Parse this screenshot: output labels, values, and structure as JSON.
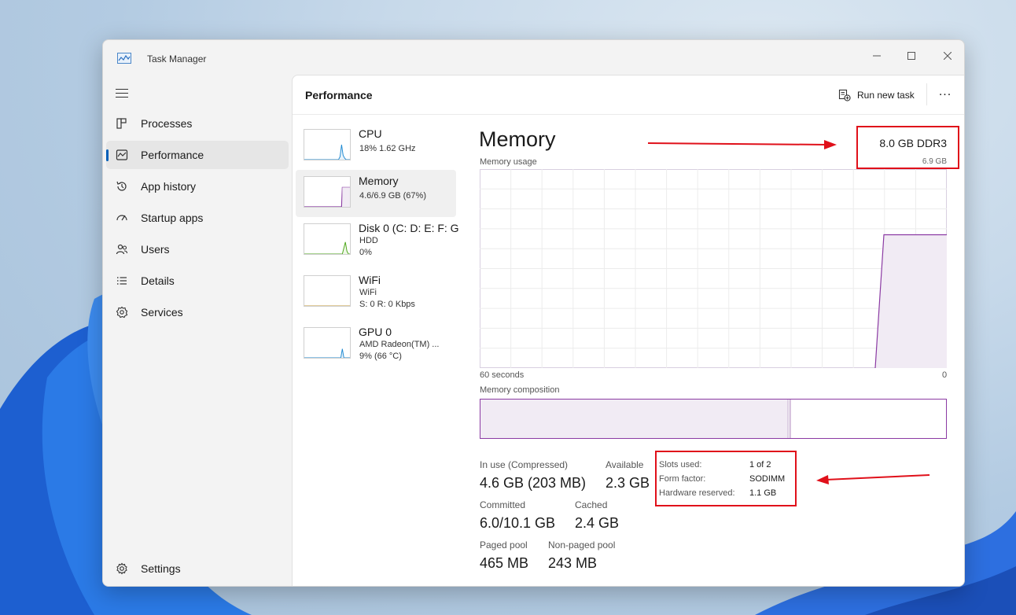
{
  "window": {
    "title": "Task Manager"
  },
  "nav": {
    "items": [
      {
        "label": "Processes",
        "icon": "processes-icon"
      },
      {
        "label": "Performance",
        "icon": "performance-icon",
        "active": true
      },
      {
        "label": "App history",
        "icon": "history-icon"
      },
      {
        "label": "Startup apps",
        "icon": "startup-icon"
      },
      {
        "label": "Users",
        "icon": "users-icon"
      },
      {
        "label": "Details",
        "icon": "details-icon"
      },
      {
        "label": "Services",
        "icon": "services-icon"
      }
    ],
    "settings_label": "Settings"
  },
  "header": {
    "title": "Performance",
    "run_new_task_label": "Run new task",
    "more_label": "..."
  },
  "resources": [
    {
      "name": "CPU",
      "line1": "18% 1.62 GHz",
      "line2": ""
    },
    {
      "name": "Memory",
      "line1": "4.6/6.9 GB (67%)",
      "line2": "",
      "active": true
    },
    {
      "name": "Disk 0 (C: D: E: F: G",
      "line1": "HDD",
      "line2": "0%"
    },
    {
      "name": "WiFi",
      "line1": "WiFi",
      "line2": "S: 0 R: 0 Kbps"
    },
    {
      "name": "GPU 0",
      "line1": "AMD Radeon(TM) ...",
      "line2": "9% (66 °C)"
    }
  ],
  "memory": {
    "title": "Memory",
    "type": "8.0 GB DDR3",
    "total_label": "6.9 GB",
    "usage_label": "Memory usage",
    "axis_left": "60 seconds",
    "axis_right": "0",
    "composition_label": "Memory composition",
    "usage_fraction": 0.67,
    "stats": {
      "in_use_label": "In use (Compressed)",
      "in_use_value": "4.6 GB (203 MB)",
      "available_label": "Available",
      "available_value": "2.3 GB",
      "committed_label": "Committed",
      "committed_value": "6.0/10.1 GB",
      "cached_label": "Cached",
      "cached_value": "2.4 GB",
      "paged_label": "Paged pool",
      "paged_value": "465 MB",
      "nonpaged_label": "Non-paged pool",
      "nonpaged_value": "243 MB"
    },
    "details": [
      {
        "label": "Slots used:",
        "value": "1 of 2"
      },
      {
        "label": "Form factor:",
        "value": "SODIMM"
      },
      {
        "label": "Hardware reserved:",
        "value": "1.1 GB"
      }
    ]
  },
  "colors": {
    "memory_accent": "#9b4fb4",
    "memory_fill": "#f1ebf4",
    "annotation": "#e0101a",
    "nav_indicator": "#005fb8"
  }
}
